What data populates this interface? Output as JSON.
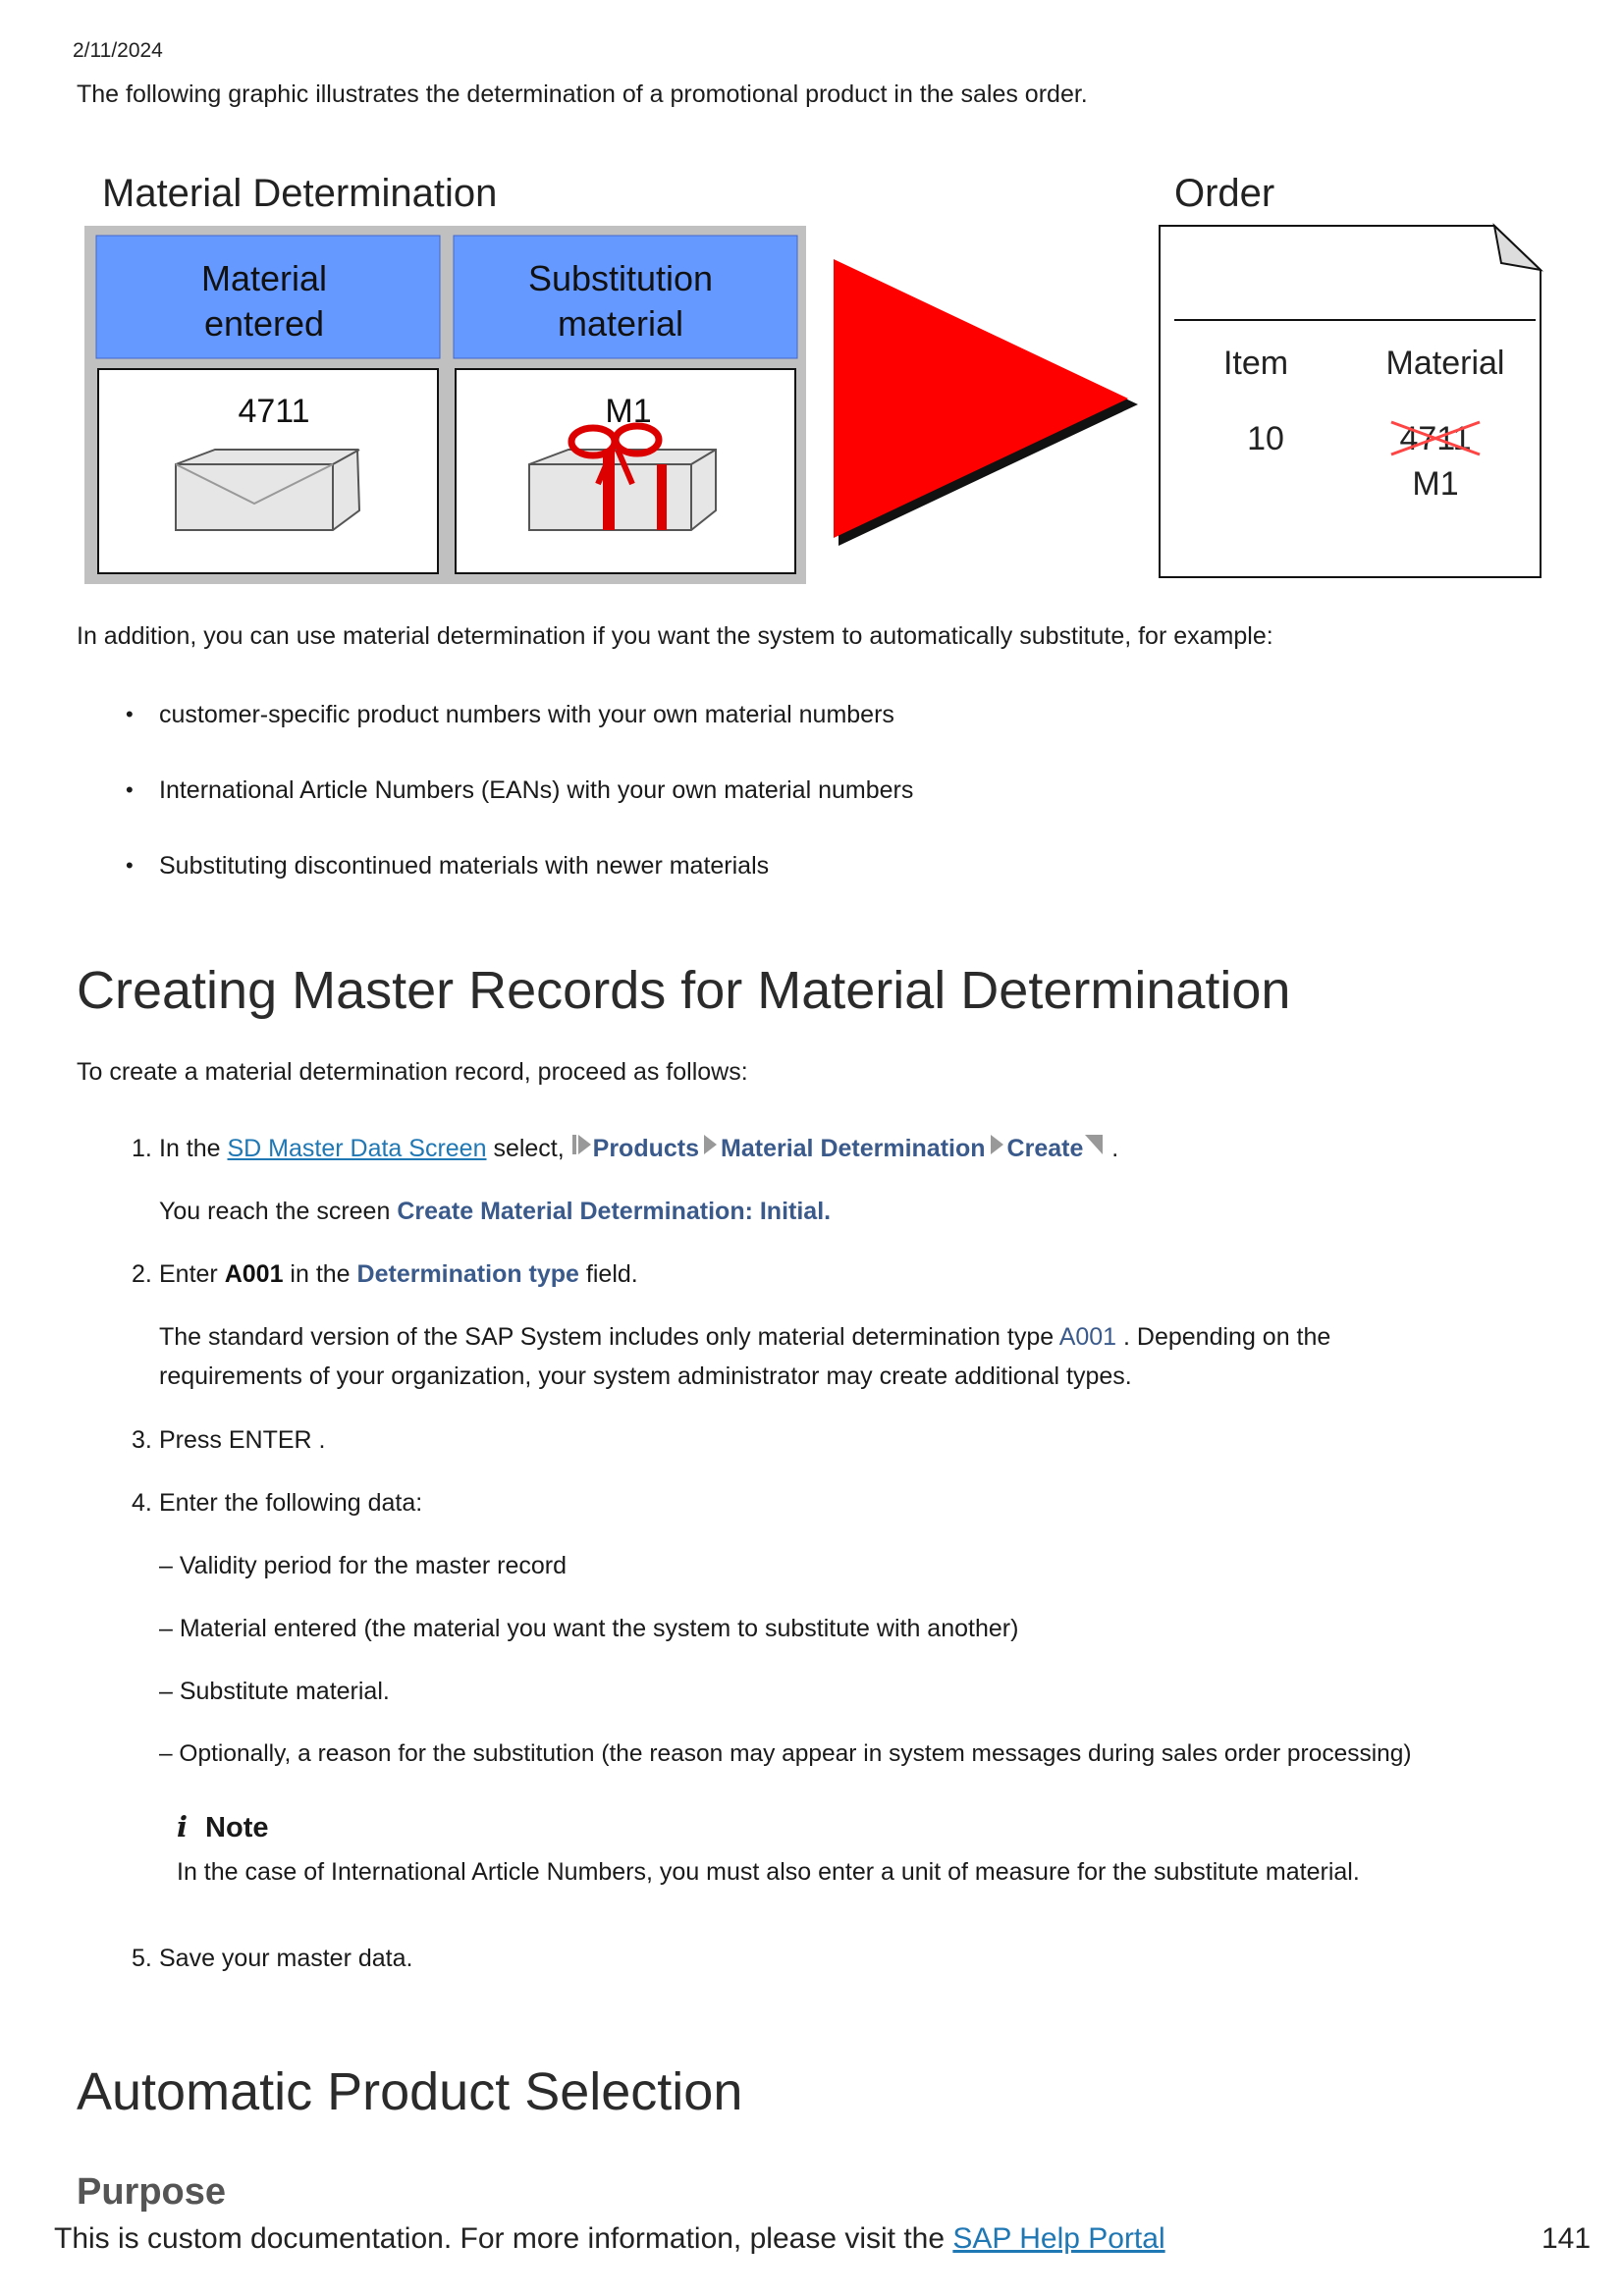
{
  "date": "2/11/2024",
  "intro": "The following graphic illustrates the determination of a promotional product in the sales order.",
  "figure": {
    "left_title": "Material Determination",
    "col1_header_line1": "Material",
    "col1_header_line2": "entered",
    "col2_header_line1": "Substitution",
    "col2_header_line2": "material",
    "col1_value": "4711",
    "col2_value": "M1",
    "order_title": "Order",
    "order_col1": "Item",
    "order_col2": "Material",
    "order_item": "10",
    "order_old_material": "4711",
    "order_new_material": "M1",
    "colors": {
      "header_blue": "#6699ff",
      "arrow_red": "#ff0000",
      "frame_gray": "#c0c0c0"
    }
  },
  "addition": "In addition, you can use material determination if you want the system to automatically substitute, for example:",
  "bullets": [
    "customer-specific product numbers with your own material numbers",
    "International Article Numbers (EANs) with your own material numbers",
    "Substituting discontinued materials with newer materials"
  ],
  "section1": {
    "title": "Creating Master Records for Material Determination",
    "lead": "To create a material determination record, proceed as follows:"
  },
  "steps": {
    "s1": {
      "num": "1.",
      "pre": "In the ",
      "link": "SD Master Data Screen",
      "mid": " select, ",
      "path1": "Products",
      "path2": "Material Determination",
      "path3": "Create",
      "end": " .",
      "result_pre": "You reach the screen ",
      "result_ui": "Create Material Determination: Initial."
    },
    "s2": {
      "num": "2.",
      "pre": "Enter ",
      "value": "A001",
      "mid": " in the ",
      "field": "Determination type",
      "end": " field.",
      "detail_pre": "The standard version of the SAP System includes only material determination type ",
      "detail_value": "A001",
      "detail_post": " . Depending on the",
      "detail_line2": "requirements of your organization, your system administrator may create additional types."
    },
    "s3": {
      "num": "3.",
      "text": "Press ENTER ."
    },
    "s4": {
      "num": "4.",
      "text": "Enter the following data:",
      "items": [
        "– Validity period for the master record",
        "– Material entered (the material you want the system to substitute with another)",
        "– Substitute material.",
        "– Optionally, a reason for the substitution (the reason may appear in system messages during sales order processing)"
      ],
      "note_icon": "i",
      "note_title": "Note",
      "note_text": "In the case of International Article Numbers, you must also enter a unit of measure for the substitute material."
    },
    "s5": {
      "num": "5.",
      "text": "Save your master data."
    }
  },
  "section2": {
    "title": "Automatic Product Selection",
    "sub": "Purpose"
  },
  "footer": {
    "text": "This is custom documentation. For more information, please visit the ",
    "link": "SAP Help Portal",
    "page": "141"
  }
}
